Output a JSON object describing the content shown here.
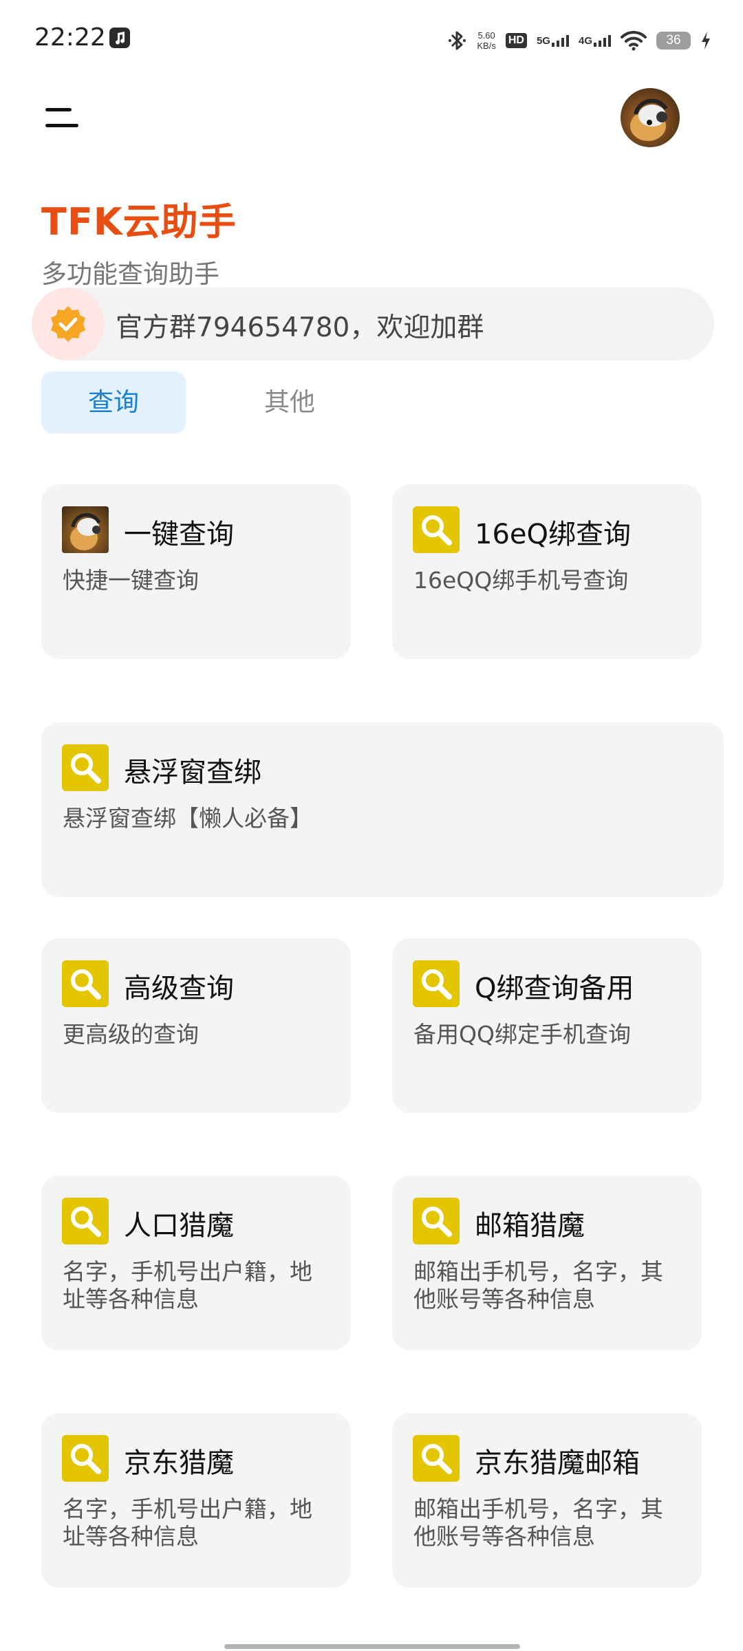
{
  "status_bar": {
    "time": "22:22",
    "speed_value": "5.60",
    "speed_unit": "KB/s",
    "hd_label": "HD",
    "sim1_label": "5G",
    "sim2_label": "4G",
    "battery": "36",
    "icons": [
      "music-app-icon",
      "bluetooth-icon",
      "wifi-icon",
      "charging-icon"
    ]
  },
  "header": {
    "title": "TFK云助手",
    "subtitle": "多功能查询助手"
  },
  "notice": {
    "text": "官方群794654780，欢迎加群",
    "icon": "verified-badge-icon"
  },
  "tabs": [
    {
      "label": "查询",
      "active": true
    },
    {
      "label": "其他",
      "active": false
    }
  ],
  "cards": [
    {
      "title": "一键查询",
      "desc": "快捷一键查询",
      "icon": "avatar-photo-icon"
    },
    {
      "title": "16eQ绑查询",
      "desc": "16eQQ绑手机号查询",
      "icon": "search-icon"
    },
    {
      "title": "悬浮窗查绑",
      "desc": "悬浮窗查绑【懒人必备】",
      "icon": "search-icon"
    },
    {
      "title": "高级查询",
      "desc": "更高级的查询",
      "icon": "search-icon"
    },
    {
      "title": "Q绑查询备用",
      "desc": "备用QQ绑定手机查询",
      "icon": "search-icon"
    },
    {
      "title": "人口猎魔",
      "desc": "名字，手机号出户籍，地址等各种信息",
      "icon": "search-icon"
    },
    {
      "title": "邮箱猎魔",
      "desc": "邮箱出手机号，名字，其他账号等各种信息",
      "icon": "search-icon"
    },
    {
      "title": "京东猎魔",
      "desc": "名字，手机号出户籍，地址等各种信息",
      "icon": "search-icon"
    },
    {
      "title": "京东猎魔邮箱",
      "desc": "邮箱出手机号，名字，其他账号等各种信息",
      "icon": "search-icon"
    }
  ],
  "colors": {
    "title": "#e84d12",
    "tab_active_bg": "#e3f1fd",
    "tab_active_text": "#1b7fd4",
    "card_bg": "#f4f4f4",
    "icon_yellow": "#e3c500",
    "badge_orange": "#f5a623"
  }
}
